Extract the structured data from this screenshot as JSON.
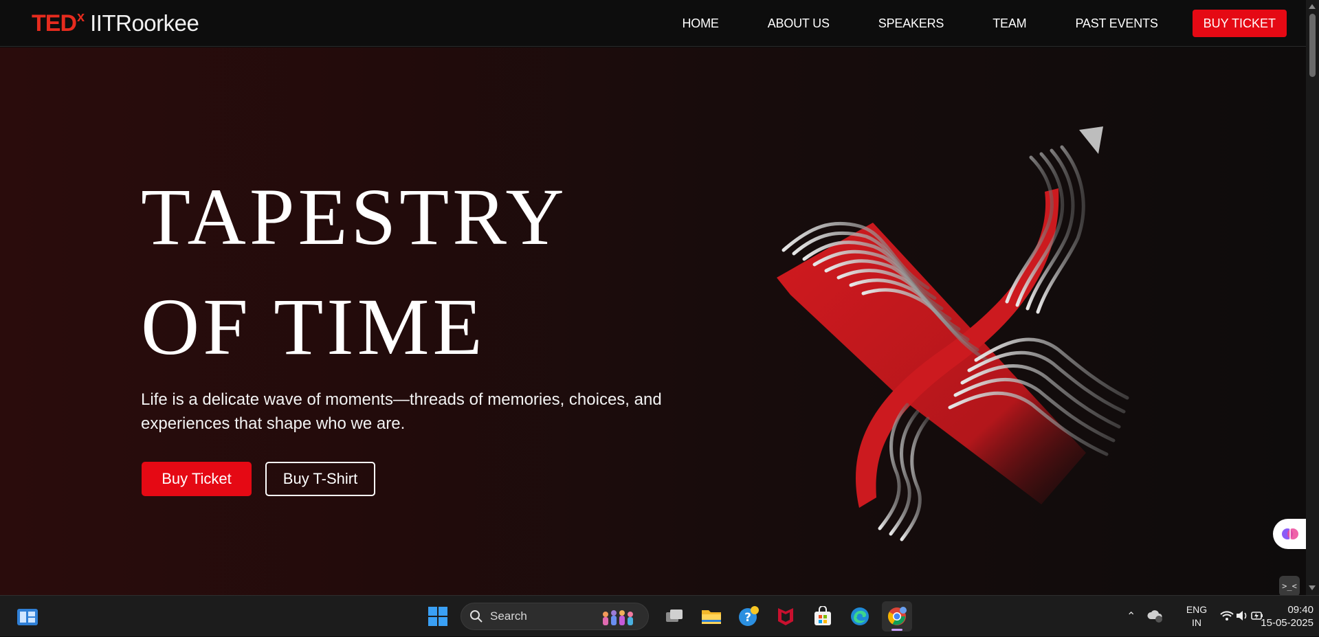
{
  "navbar": {
    "logo": {
      "ted": "TED",
      "x": "x",
      "org": "IITRoorkee"
    },
    "links": [
      "HOME",
      "ABOUT US",
      "SPEAKERS",
      "TEAM",
      "PAST EVENTS"
    ],
    "buy_label": "BUY TICKET"
  },
  "hero": {
    "title_line1": "TAPESTRY",
    "title_line2": "OF TIME",
    "description": "Life is a delicate wave of moments—threads of memories, choices, and experiences that shape who we are.",
    "primary_button": "Buy Ticket",
    "secondary_button": "Buy T-Shirt",
    "art_icon": "x-ribbon-artwork",
    "float_ai_icon": "brain-icon",
    "float_terminal_label": ">_<"
  },
  "taskbar": {
    "search_placeholder": "Search",
    "language": {
      "line1": "ENG",
      "line2": "IN"
    },
    "time": "09:40",
    "date": "15-05-2025",
    "apps": [
      "task-view-icon",
      "file-explorer-icon",
      "get-help-icon",
      "mcafee-icon",
      "microsoft-store-icon",
      "edge-icon",
      "chrome-icon"
    ]
  },
  "colors": {
    "accent": "#e50914",
    "ted_red": "#e62b1e",
    "bg": "#0d0d0d"
  }
}
